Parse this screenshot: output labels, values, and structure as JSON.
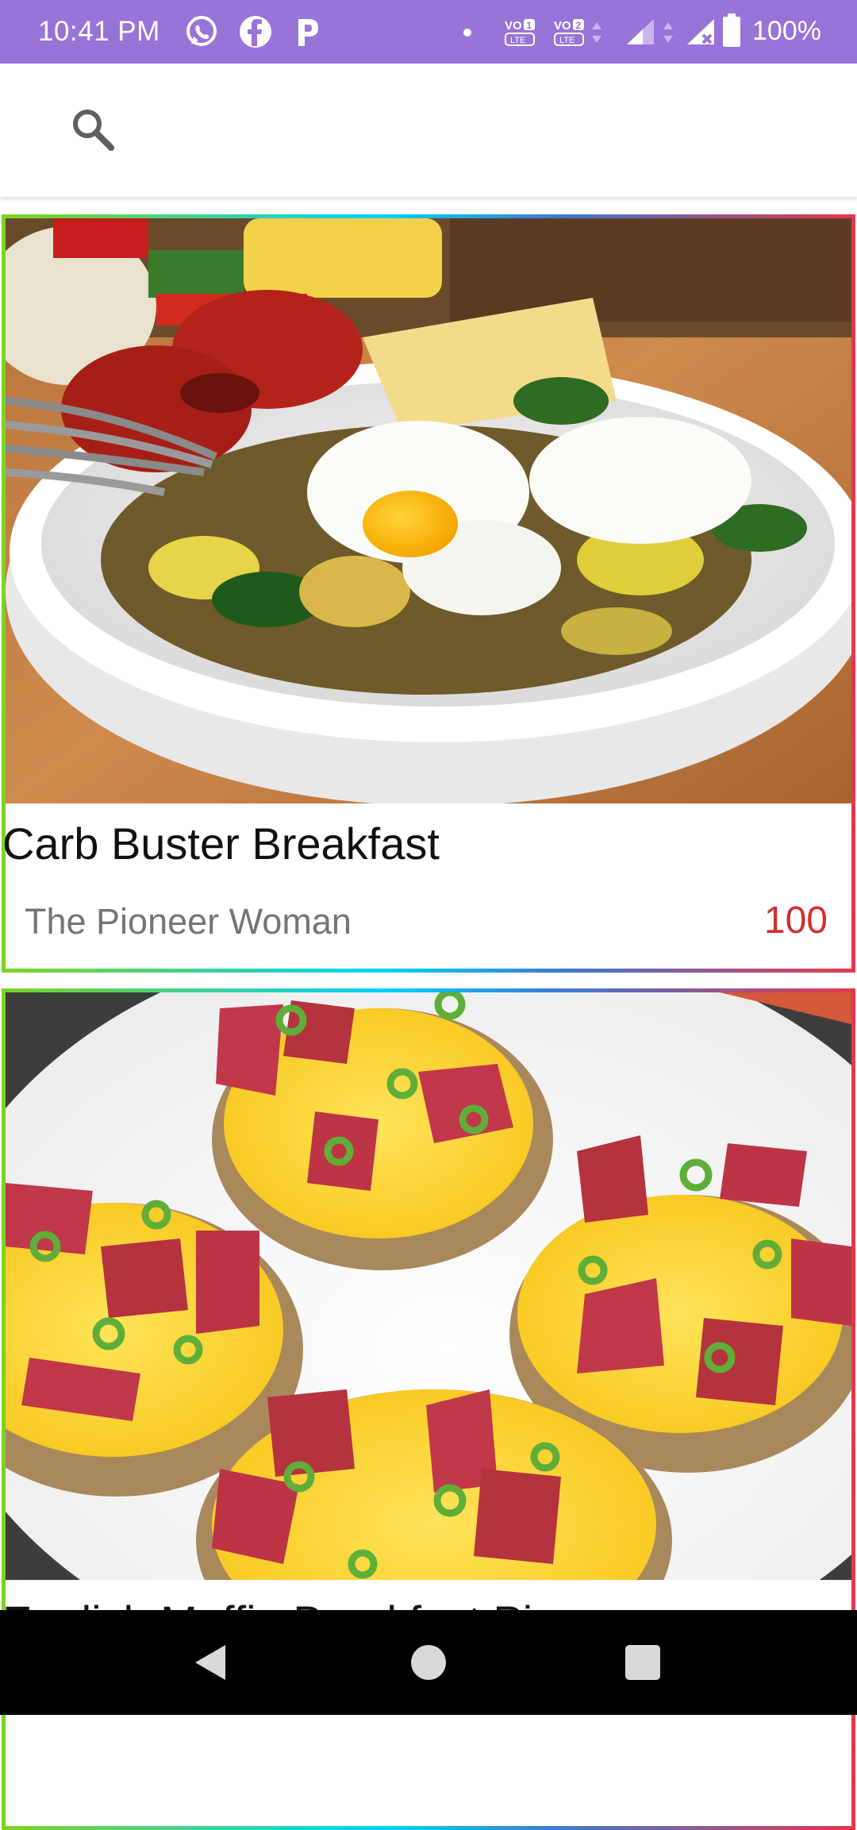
{
  "status_bar": {
    "time": "10:41 PM",
    "apps": [
      "whatsapp-icon",
      "facebook-icon",
      "paytm-icon"
    ],
    "volte1": "VO 1 LTE",
    "volte2": "VO 2 LTE",
    "battery": "100%",
    "color": "#9873d8"
  },
  "toolbar": {
    "search_icon": "search-icon"
  },
  "recipes": [
    {
      "title": "Carb Buster Breakfast",
      "source": "The Pioneer Woman",
      "score": "100",
      "image": "poached eggs with roasted tomatoes and vegetables in a white bowl"
    },
    {
      "title": "English Muffin Breakfast Pizzas",
      "source": "",
      "score": "",
      "image": "english muffins topped with scrambled eggs, cheese, salami and green onions"
    }
  ],
  "nav": {
    "back": "back-icon",
    "home": "home-icon",
    "recents": "recents-icon"
  },
  "colors": {
    "score": "#d32f2f",
    "border_gradient": [
      "#7ed321",
      "#00d2ff",
      "#3a7bd5",
      "#e8364a"
    ]
  }
}
